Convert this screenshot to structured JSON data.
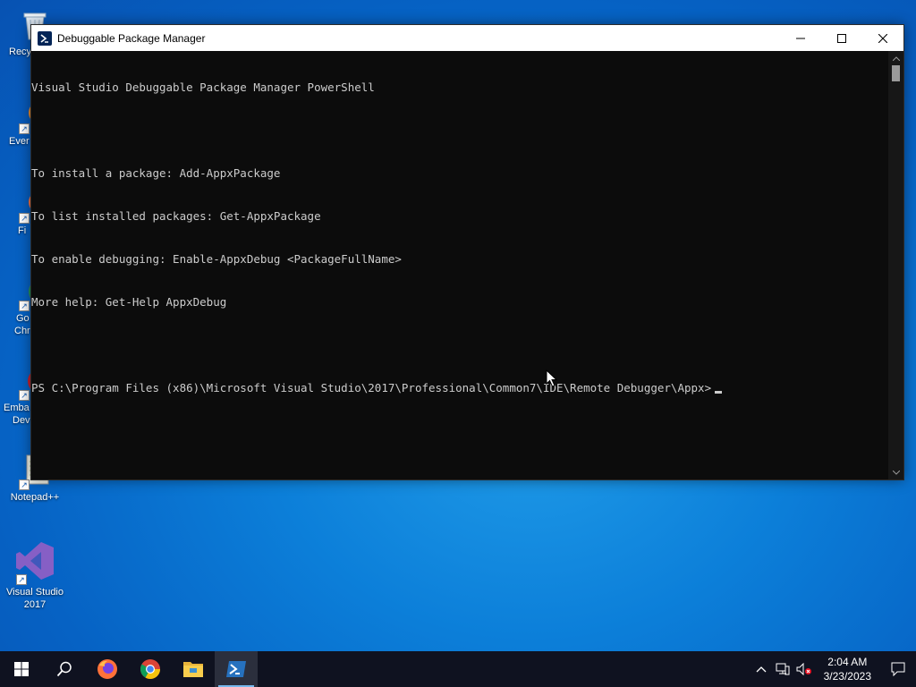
{
  "desktop": {
    "icons": [
      {
        "label": "Recy"
      },
      {
        "label": "Ever"
      },
      {
        "label": "Fi"
      },
      {
        "label_line1": "Go",
        "label_line2": "Chr"
      },
      {
        "label_line1": "Emba",
        "label_line2": "Dev"
      },
      {
        "label": "Notepad++"
      },
      {
        "label_line1": "Visual Studio",
        "label_line2": "2017"
      }
    ]
  },
  "window": {
    "title": "Debuggable Package Manager",
    "icon": "powershell-icon",
    "controls": [
      "minimize-icon",
      "maximize-icon",
      "close-icon"
    ]
  },
  "console": {
    "lines": [
      "Visual Studio Debuggable Package Manager PowerShell",
      "",
      "To install a package: Add-AppxPackage",
      "To list installed packages: Get-AppxPackage",
      "To enable debugging: Enable-AppxDebug <PackageFullName>",
      "More help: Get-Help AppxDebug",
      "",
      "PS C:\\Program Files (x86)\\Microsoft Visual Studio\\2017\\Professional\\Common7\\IDE\\Remote Debugger\\Appx>"
    ],
    "foreground": "#cccccc",
    "background": "#0c0c0c"
  },
  "taskbar": {
    "buttons": [
      "windows-start-icon",
      "search-icon",
      "firefox-icon",
      "chrome-icon",
      "file-explorer-icon",
      "powershell-icon"
    ],
    "active": "powershell-icon",
    "tray": {
      "icons": [
        "chevron-up-icon",
        "network-icon",
        "volume-muted-icon"
      ],
      "time": "2:04 AM",
      "date": "3/23/2023"
    }
  },
  "colors": {
    "accent": "#76b9ed",
    "taskbar": "#0f1220"
  }
}
